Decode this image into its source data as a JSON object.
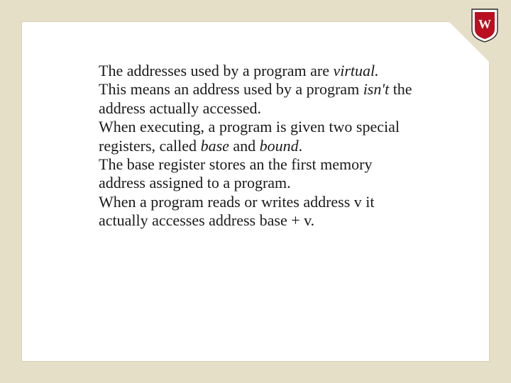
{
  "logo": {
    "letter": "W"
  },
  "slide": {
    "p1a": "The addresses used by a program are ",
    "p1b": "virtual.",
    "p2a": "This means an address used by a program ",
    "p2b": "isn't",
    "p2c": " the address actually accessed.",
    "p3a": "When executing, a program is given two special registers, called ",
    "p3b": "base",
    "p3c": " and ",
    "p3d": "bound",
    "p3e": ".",
    "p4": "The base register stores an the first memory address assigned to a program.",
    "p5": "When a program reads or writes address v it actually accesses address base + v."
  }
}
